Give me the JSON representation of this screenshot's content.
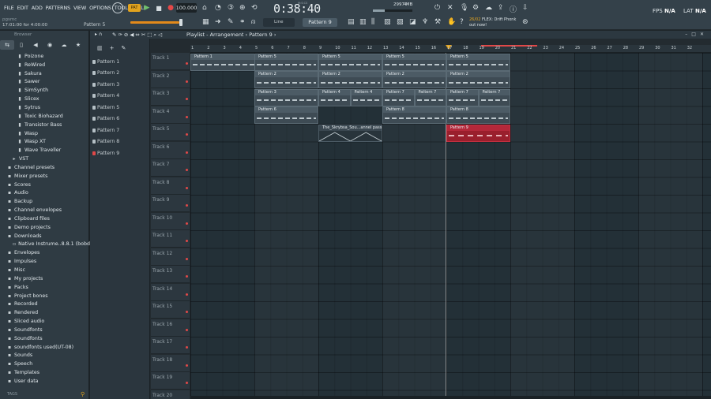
{
  "menu": [
    "FILE",
    "EDIT",
    "ADD",
    "PATTERNS",
    "VIEW",
    "OPTIONS",
    "TOOLS",
    "HELP"
  ],
  "hint": {
    "line1": "pgsmc",
    "line2": "17:01:00 for 4:00:00",
    "pattern": "Pattern 5"
  },
  "transport": {
    "tempo": "100.000",
    "time": "0:38:40",
    "time_label": "M:S:CS",
    "cpu": "2997 MB",
    "voices": "4",
    "play_icon": "play-icon",
    "stop_icon": "stop-icon",
    "record_icon": "record-icon"
  },
  "news": {
    "line1_date": "26/02",
    "line1_text": "FLEX: Drift Phonk",
    "line2": "out now!"
  },
  "meters": {
    "fps_label": "FPS",
    "fps_value": "N/A",
    "lat_label": "LAT",
    "lat_value": "N/A"
  },
  "toolbar": {
    "snap": "Line",
    "pattern": "Pattern 9"
  },
  "browser": {
    "title": "Browser",
    "items": [
      {
        "label": "Poizone",
        "kind": "plug"
      },
      {
        "label": "ReWired",
        "kind": "plug"
      },
      {
        "label": "Sakura",
        "kind": "plug"
      },
      {
        "label": "Sawer",
        "kind": "plug"
      },
      {
        "label": "SimSynth",
        "kind": "plug"
      },
      {
        "label": "Slicex",
        "kind": "plug"
      },
      {
        "label": "Sytrus",
        "kind": "plug"
      },
      {
        "label": "Toxic Biohazard",
        "kind": "plug"
      },
      {
        "label": "Transistor Bass",
        "kind": "plug"
      },
      {
        "label": "Wasp",
        "kind": "plug"
      },
      {
        "label": "Wasp XT",
        "kind": "plug"
      },
      {
        "label": "Wave Traveller",
        "kind": "plug"
      },
      {
        "label": "VST",
        "kind": "vst"
      },
      {
        "label": "Channel presets",
        "kind": "root"
      },
      {
        "label": "Mixer presets",
        "kind": "root"
      },
      {
        "label": "Scores",
        "kind": "root"
      },
      {
        "label": "Audio",
        "kind": "root"
      },
      {
        "label": "Backup",
        "kind": "root"
      },
      {
        "label": "Channel envelopes",
        "kind": "root"
      },
      {
        "label": "Clipboard files",
        "kind": "root"
      },
      {
        "label": "Demo projects",
        "kind": "root"
      },
      {
        "label": "Downloads",
        "kind": "root"
      },
      {
        "label": "Native Instrume..8.8.1 (bobdule)",
        "kind": "sub"
      },
      {
        "label": "Envelopes",
        "kind": "root"
      },
      {
        "label": "Impulses",
        "kind": "root"
      },
      {
        "label": "Misc",
        "kind": "root"
      },
      {
        "label": "My projects",
        "kind": "root"
      },
      {
        "label": "Packs",
        "kind": "root"
      },
      {
        "label": "Project bones",
        "kind": "root"
      },
      {
        "label": "Recorded",
        "kind": "root"
      },
      {
        "label": "Rendered",
        "kind": "root"
      },
      {
        "label": "Sliced audio",
        "kind": "root"
      },
      {
        "label": "Soundfonts",
        "kind": "root"
      },
      {
        "label": "Soundfonts",
        "kind": "root"
      },
      {
        "label": "soundfonts used(UT-08)",
        "kind": "root"
      },
      {
        "label": "Sounds",
        "kind": "root"
      },
      {
        "label": "Speech",
        "kind": "root"
      },
      {
        "label": "Templates",
        "kind": "root"
      },
      {
        "label": "User data",
        "kind": "root"
      }
    ],
    "tags_label": "TAGS"
  },
  "playlist": {
    "title": "Playlist - Arrangement",
    "breadcrumb": "Pattern 9",
    "patterns": [
      "Pattern 1",
      "Pattern 2",
      "Pattern 3",
      "Pattern 4",
      "Pattern 5",
      "Pattern 6",
      "Pattern 7",
      "Pattern 8",
      "Pattern 9"
    ],
    "selected_pattern": "Pattern 9",
    "tracks": [
      "Track 1",
      "Track 2",
      "Track 3",
      "Track 4",
      "Track 5",
      "Track 6",
      "Track 7",
      "Track 8",
      "Track 9",
      "Track 10",
      "Track 11",
      "Track 12",
      "Track 13",
      "Track 14",
      "Track 15",
      "Track 16",
      "Track 17",
      "Track 18",
      "Track 19",
      "Track 20"
    ],
    "bars": [
      "1",
      "2",
      "3",
      "4",
      "5",
      "6",
      "7",
      "8",
      "9",
      "10",
      "11",
      "12",
      "13",
      "14",
      "15",
      "16",
      "17",
      "18",
      "19",
      "20",
      "21",
      "22",
      "23",
      "24",
      "25",
      "26",
      "27",
      "28",
      "29",
      "30",
      "31",
      "32"
    ],
    "clips": [
      {
        "label": "Pattern 1",
        "track": 1,
        "start": 1,
        "length": 8,
        "color": "gray"
      },
      {
        "label": "Pattern 1",
        "track": 1,
        "start": 9,
        "length": 4,
        "color": "gray"
      },
      {
        "label": "Pattern 5",
        "track": 1,
        "start": 5,
        "length": 4,
        "color": "gray"
      },
      {
        "label": "Pattern 5",
        "track": 1,
        "start": 9,
        "length": 4,
        "color": "gray"
      },
      {
        "label": "Pattern 5",
        "track": 1,
        "start": 13,
        "length": 4,
        "color": "gray"
      },
      {
        "label": "Pattern 5",
        "track": 1,
        "start": 17,
        "length": 4,
        "color": "gray"
      },
      {
        "label": "Pattern 2",
        "track": 2,
        "start": 5,
        "length": 4,
        "color": "gray"
      },
      {
        "label": "Pattern 2",
        "track": 2,
        "start": 9,
        "length": 4,
        "color": "gray"
      },
      {
        "label": "Pattern 2",
        "track": 2,
        "start": 13,
        "length": 4,
        "color": "gray"
      },
      {
        "label": "Pattern 2",
        "track": 2,
        "start": 17,
        "length": 4,
        "color": "gray"
      },
      {
        "label": "Pattern 3",
        "track": 3,
        "start": 5,
        "length": 4,
        "color": "gray"
      },
      {
        "label": "Pattern 4",
        "track": 3,
        "start": 9,
        "length": 2,
        "color": "gray"
      },
      {
        "label": "Pattern 4",
        "track": 3,
        "start": 11,
        "length": 2,
        "color": "gray"
      },
      {
        "label": "Pattern 7",
        "track": 3,
        "start": 13,
        "length": 2,
        "color": "gray"
      },
      {
        "label": "Pattern 7",
        "track": 3,
        "start": 15,
        "length": 2,
        "color": "gray"
      },
      {
        "label": "Pattern 7",
        "track": 3,
        "start": 17,
        "length": 2,
        "color": "gray"
      },
      {
        "label": "Pattern 7",
        "track": 3,
        "start": 19,
        "length": 2,
        "color": "gray"
      },
      {
        "label": "Pattern 6",
        "track": 4,
        "start": 5,
        "length": 4,
        "color": "gray"
      },
      {
        "label": "Pattern 8",
        "track": 4,
        "start": 13,
        "length": 4,
        "color": "gray"
      },
      {
        "label": "Pattern 8",
        "track": 4,
        "start": 17,
        "length": 4,
        "color": "gray"
      },
      {
        "label": "The_Skrybsa_Sou...annel passing",
        "track": 5,
        "start": 9,
        "length": 4,
        "color": "audio"
      },
      {
        "label": "Pattern 9",
        "track": 5,
        "start": 17,
        "length": 4,
        "color": "red"
      }
    ]
  },
  "colors": {
    "accent": "#e2a31e",
    "selected_clip": "#9a1f2d",
    "record": "#e54848"
  }
}
